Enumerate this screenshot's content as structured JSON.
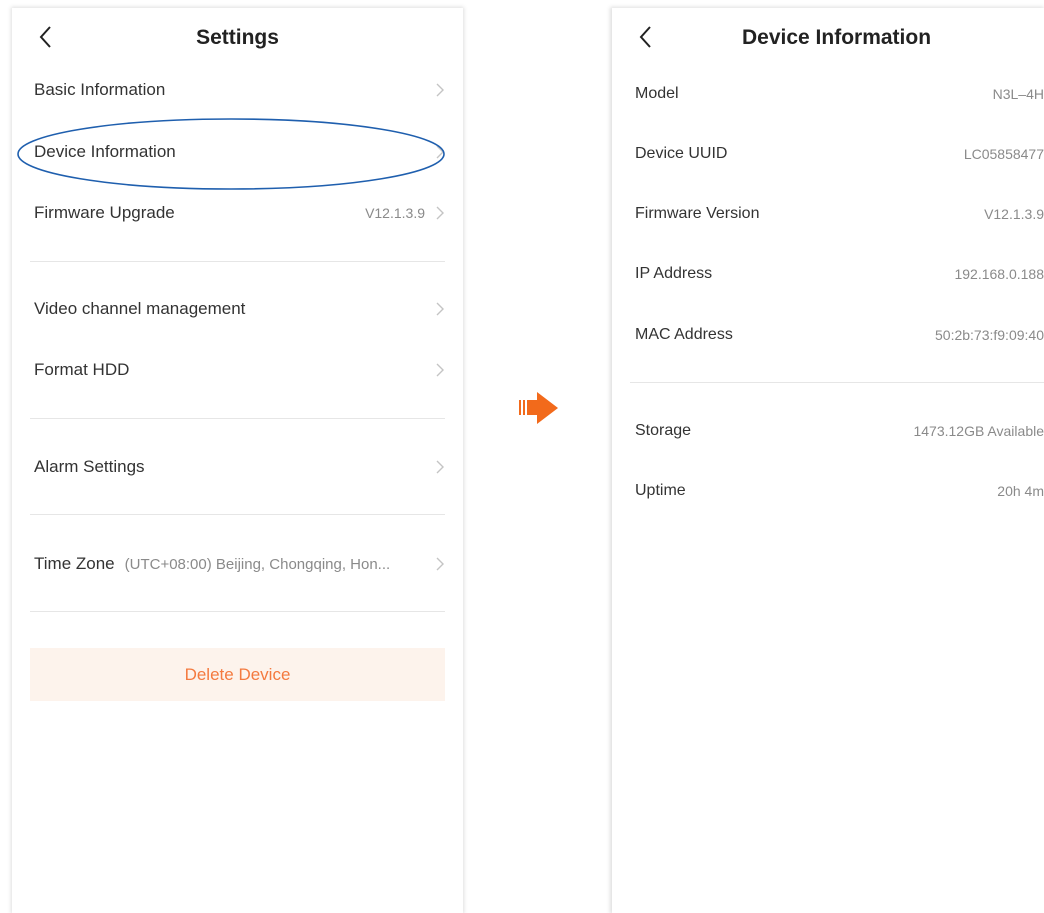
{
  "settings_screen": {
    "title": "Settings",
    "items": [
      {
        "label": "Basic Information",
        "value": ""
      },
      {
        "label": "Device Information",
        "value": ""
      },
      {
        "label": "Firmware Upgrade",
        "value": "V12.1.3.9"
      },
      {
        "label": "Video channel management",
        "value": ""
      },
      {
        "label": "Format HDD",
        "value": ""
      },
      {
        "label": "Alarm Settings",
        "value": ""
      }
    ],
    "time_zone": {
      "label": "Time Zone",
      "value": "(UTC+08:00) Beijing, Chongqing, Hon..."
    },
    "delete_label": "Delete Device"
  },
  "device_info_screen": {
    "title": "Device Information",
    "items": [
      {
        "label": "Model",
        "value": "N3L–4H"
      },
      {
        "label": "Device UUID",
        "value": "LC05858477"
      },
      {
        "label": "Firmware Version",
        "value": "V12.1.3.9"
      },
      {
        "label": "IP Address",
        "value": "192.168.0.188"
      },
      {
        "label": "MAC Address",
        "value": "50:2b:73:f9:09:40"
      },
      {
        "label": "Storage",
        "value": "1473.12GB Available"
      },
      {
        "label": "Uptime",
        "value": "20h 4m"
      }
    ]
  },
  "colors": {
    "accent": "#f47a3f",
    "highlight_oval": "#1f5fae",
    "delete_bg": "#fdf3ec",
    "arrow": "#f26a1b"
  },
  "icons": {
    "back": "chevron-left-icon",
    "chevron": "chevron-right-icon",
    "arrow": "arrow-right-icon"
  }
}
